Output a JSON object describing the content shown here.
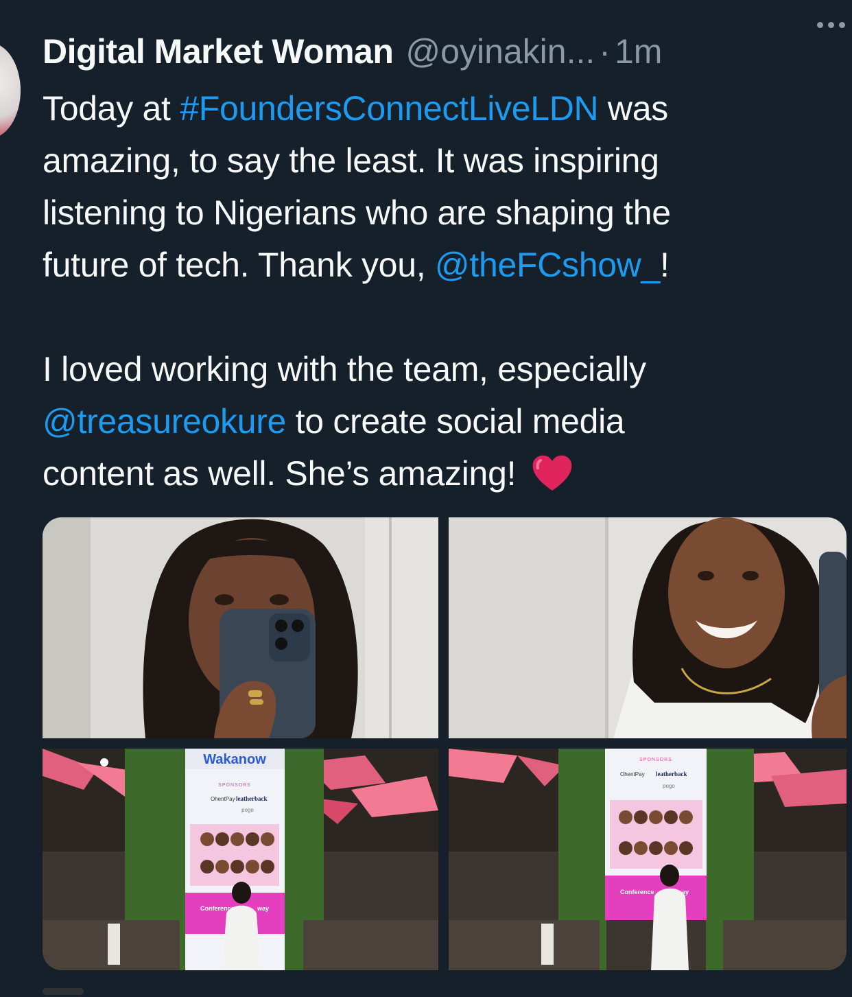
{
  "tweet": {
    "display_name": "Digital Market Woman",
    "handle": "@oyinakin...",
    "separator": "·",
    "time": "1m",
    "text": {
      "l1_a": "Today at ",
      "l1_link": "#FoundersConnectLiveLDN",
      "l1_b": " was",
      "l2": "amazing, to say the least. It was inspiring",
      "l3": "listening to Nigerians who are shaping the",
      "l4_a": "future of tech. Thank you, ",
      "l4_link": "@theFCshow_",
      "l4_b": "!",
      "l5": "I loved working with the team, especially",
      "l6_link": "@treasureokure",
      "l6_b": " to create social media",
      "l7": "content as well. She’s amazing!"
    }
  },
  "media": {
    "photos": [
      {
        "name": "mirror selfie with phone"
      },
      {
        "name": "smiling selfie"
      },
      {
        "name": "event stage screen photo left",
        "screen": {
          "brand": "Wakanow",
          "sponsors": "SPONSORS",
          "sponsor_1": "OhentPay",
          "sponsor_2": "leatherback",
          "sponsor_3": "pogo",
          "banner": "Conference",
          "banner_end": "way"
        }
      },
      {
        "name": "event stage screen photo right",
        "screen": {
          "sponsors": "SPONSORS",
          "sponsor_1": "OhentPay",
          "sponsor_2": "leatherback",
          "sponsor_3": "pogo",
          "banner": "Conference",
          "banner_end": "ay"
        }
      }
    ]
  },
  "colors": {
    "background": "#15202b",
    "text": "#f7f9f9",
    "secondary": "#8b98a5",
    "link": "#1d9bf0",
    "heart": "#e0245e"
  },
  "icons": [
    "avatar",
    "more-icon",
    "heart-icon"
  ]
}
